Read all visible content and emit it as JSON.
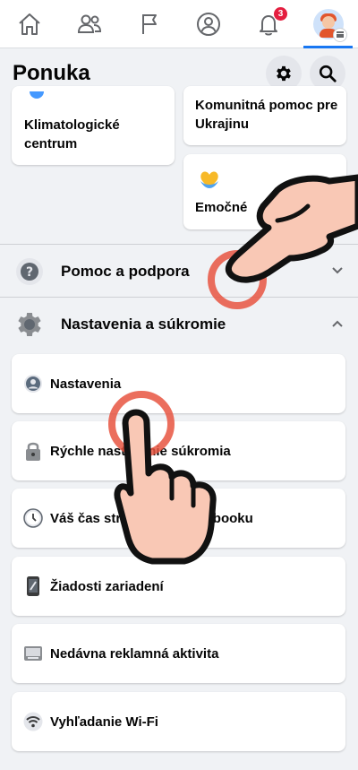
{
  "nav": {
    "notification_badge": "3"
  },
  "header": {
    "title": "Ponuka"
  },
  "shortcuts": {
    "climate_label": "Klimatologické centrum",
    "ukraine_label": "Komunitná pomoc pre Ukrajinu",
    "emotional_label": "Emočné"
  },
  "sections": {
    "help_label": "Pomoc a podpora",
    "settings_label": "Nastavenia a súkromie"
  },
  "settings_items": [
    {
      "label": "Nastavenia",
      "icon": "person-icon"
    },
    {
      "label": "Rýchle nastavenie súkromia",
      "icon": "lock-icon"
    },
    {
      "label": "Váš čas strávený na Facebooku",
      "icon": "clock-icon"
    },
    {
      "label": "Žiadosti zariadení",
      "icon": "device-icon"
    },
    {
      "label": "Nedávna reklamná aktivita",
      "icon": "ad-icon"
    },
    {
      "label": "Vyhľadanie Wi‑Fi",
      "icon": "wifi-icon"
    }
  ],
  "colors": {
    "accent": "#1877f2",
    "badge": "#e41e3f",
    "tap_ring": "#e85541",
    "hand": "#f9c8b5"
  }
}
